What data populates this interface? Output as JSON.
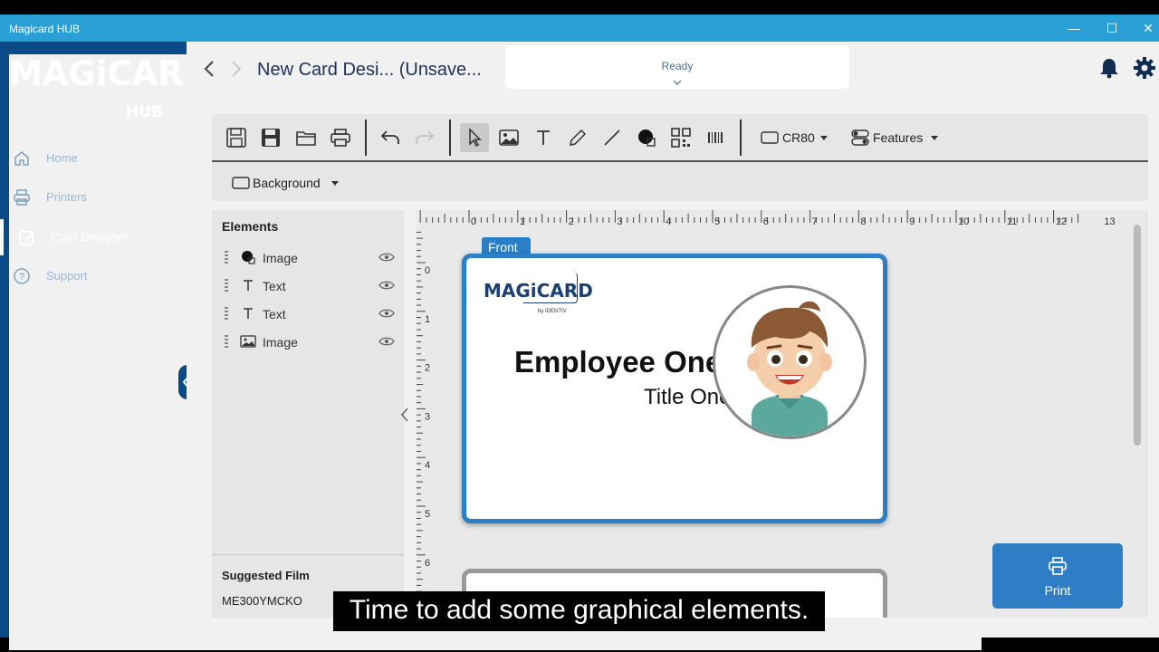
{
  "window": {
    "title": "Magicard HUB"
  },
  "sidebar": {
    "logo_main": "MAGiCARD",
    "logo_sub": "HUB",
    "items": [
      {
        "label": "Home",
        "icon": "home-icon",
        "active": false
      },
      {
        "label": "Printers",
        "icon": "printer-icon",
        "active": false
      },
      {
        "label": "Card Designer",
        "icon": "edit-icon",
        "active": true
      },
      {
        "label": "Support",
        "icon": "help-icon",
        "active": false
      }
    ]
  },
  "header": {
    "title": "New Card Desi...  (Unsave...",
    "status": "Ready"
  },
  "toolbar": {
    "card_size": "CR80",
    "features": "Features",
    "background": "Background"
  },
  "elements_panel": {
    "title": "Elements",
    "items": [
      {
        "label": "Image",
        "icon": "shape-icon"
      },
      {
        "label": "Text",
        "icon": "text-icon"
      },
      {
        "label": "Text",
        "icon": "text-icon"
      },
      {
        "label": "Image",
        "icon": "image-icon"
      }
    ],
    "suggested_film_label": "Suggested Film",
    "suggested_film_value": "ME300YMCKO"
  },
  "canvas": {
    "side_label": "Front",
    "ruler_h": [
      "0",
      "1",
      "2",
      "3",
      "4",
      "5",
      "6",
      "7",
      "8",
      "9",
      "10",
      "11",
      "12",
      "13"
    ],
    "ruler_v": [
      "0",
      "1",
      "2",
      "3",
      "4",
      "5",
      "6"
    ],
    "card": {
      "logo_text": "MAGiCARD",
      "logo_sub": "by IDENTIV",
      "name": "Employee One",
      "title": "Title One"
    }
  },
  "print_button": {
    "label": "Print"
  },
  "caption": "Time to add some graphical elements.",
  "colors": {
    "sidebar": "#0a4a86",
    "titlebar": "#2a9fd6",
    "accent": "#2a7fc6"
  }
}
